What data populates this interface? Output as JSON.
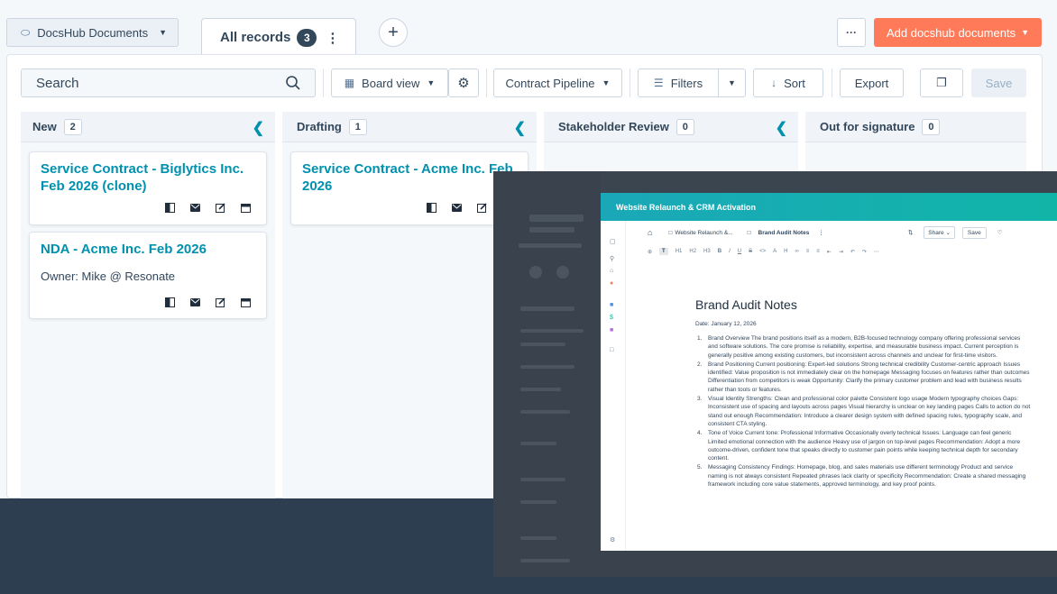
{
  "header": {
    "object_selector": "DocsHub Documents",
    "active_tab": "All records",
    "active_tab_count": "3",
    "add_button": "Add docshub documents"
  },
  "toolbar": {
    "search_placeholder": "Search",
    "board_view": "Board view",
    "pipeline": "Contract Pipeline",
    "filters": "Filters",
    "sort": "Sort",
    "export": "Export",
    "save": "Save"
  },
  "columns": [
    {
      "title": "New",
      "count": "2"
    },
    {
      "title": "Drafting",
      "count": "1"
    },
    {
      "title": "Stakeholder Review",
      "count": "0"
    },
    {
      "title": "Out for signature",
      "count": "0"
    }
  ],
  "cards": [
    {
      "title": "Service Contract - Biglytics Inc. Feb 2026 (clone)",
      "owner": ""
    },
    {
      "title": "NDA - Acme Inc. Feb 2026",
      "owner": "Owner: Mike @ Resonate"
    },
    {
      "title": "Service Contract - Acme Inc. Feb 2026",
      "owner": ""
    }
  ],
  "overlay": {
    "modal_title": "Website Relaunch & CRM Activation",
    "breadcrumb": "Website Relaunch &...",
    "doc_tab": "Brand Audit Notes",
    "share": "Share",
    "save": "Save",
    "doc_title": "Brand Audit Notes",
    "date": "Date: January 12, 2026",
    "items": [
      "Brand Overview The brand positions itself as a modern, B2B-focused technology company offering professional services and software solutions. The core promise is reliability, expertise, and measurable business impact. Current perception is generally positive among existing customers, but inconsistent across channels and unclear for first-time visitors.",
      "Brand Positioning Current positioning: Expert-led solutions Strong technical credibility Customer-centric approach Issues identified: Value proposition is not immediately clear on the homepage Messaging focuses on features rather than outcomes Differentiation from competitors is weak Opportunity: Clarify the primary customer problem and lead with business results rather than tools or features.",
      "Visual Identity Strengths: Clean and professional color palette Consistent logo usage Modern typography choices Gaps: Inconsistent use of spacing and layouts across pages Visual hierarchy is unclear on key landing pages Calls to action do not stand out enough Recommendation: Introduce a clearer design system with defined spacing rules, typography scale, and consistent CTA styling.",
      "Tone of Voice Current tone: Professional Informative Occasionally overly technical Issues: Language can feel generic Limited emotional connection with the audience Heavy use of jargon on top-level pages Recommendation: Adopt a more outcome-driven, confident tone that speaks directly to customer pain points while keeping technical depth for secondary content.",
      "Messaging Consistency Findings: Homepage, blog, and sales materials use different terminology Product and service naming is not always consistent Repeated phrases lack clarity or specificity Recommendation: Create a shared messaging framework including core value statements, approved terminology, and key proof points."
    ]
  },
  "colors": {
    "accent": "#0091ae",
    "cta": "#ff7a59",
    "text": "#33475b",
    "backdrop": "#2d3e50",
    "modal_header": "#1aa8b8"
  }
}
